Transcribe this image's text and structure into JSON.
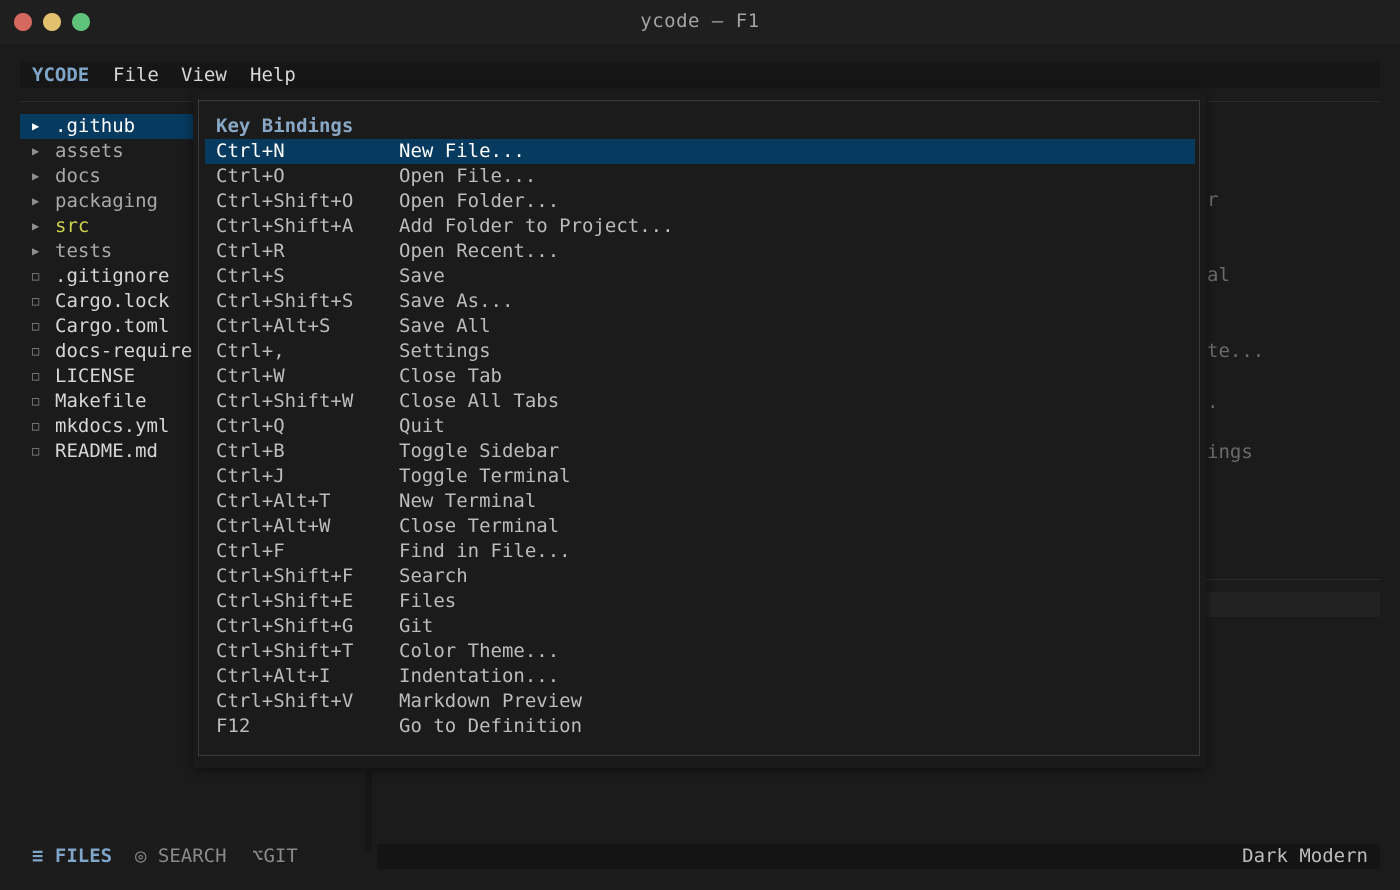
{
  "window": {
    "title": "ycode — F1"
  },
  "menubar": {
    "brand": "YCODE",
    "items": [
      "File",
      "View",
      "Help"
    ]
  },
  "sidebar": {
    "tree": [
      {
        "name": ".github",
        "type": "dir",
        "selected": true
      },
      {
        "name": "assets",
        "type": "dir"
      },
      {
        "name": "docs",
        "type": "dir"
      },
      {
        "name": "packaging",
        "type": "dir"
      },
      {
        "name": "src",
        "type": "dir",
        "modified": true
      },
      {
        "name": "tests",
        "type": "dir"
      },
      {
        "name": ".gitignore",
        "type": "file"
      },
      {
        "name": "Cargo.lock",
        "type": "file"
      },
      {
        "name": "Cargo.toml",
        "type": "file"
      },
      {
        "name": "docs-require",
        "type": "file"
      },
      {
        "name": "LICENSE",
        "type": "file"
      },
      {
        "name": "Makefile",
        "type": "file"
      },
      {
        "name": "mkdocs.yml",
        "type": "file"
      },
      {
        "name": "README.md",
        "type": "file"
      }
    ],
    "tabs": {
      "files": "≡ FILES",
      "search": "◎ SEARCH",
      "git": "⌥GIT"
    }
  },
  "background_text": [
    "r",
    "al",
    "te...",
    ".",
    "ings"
  ],
  "modal": {
    "title": "Key Bindings",
    "bindings": [
      {
        "key": "Ctrl+N",
        "action": "New File...",
        "selected": true
      },
      {
        "key": "Ctrl+O",
        "action": "Open File..."
      },
      {
        "key": "Ctrl+Shift+O",
        "action": "Open Folder..."
      },
      {
        "key": "Ctrl+Shift+A",
        "action": "Add Folder to Project..."
      },
      {
        "key": "Ctrl+R",
        "action": "Open Recent..."
      },
      {
        "key": "Ctrl+S",
        "action": "Save"
      },
      {
        "key": "Ctrl+Shift+S",
        "action": "Save As..."
      },
      {
        "key": "Ctrl+Alt+S",
        "action": "Save All"
      },
      {
        "key": "Ctrl+,",
        "action": "Settings"
      },
      {
        "key": "Ctrl+W",
        "action": "Close Tab"
      },
      {
        "key": "Ctrl+Shift+W",
        "action": "Close All Tabs"
      },
      {
        "key": "Ctrl+Q",
        "action": "Quit"
      },
      {
        "key": "Ctrl+B",
        "action": "Toggle Sidebar"
      },
      {
        "key": "Ctrl+J",
        "action": "Toggle Terminal"
      },
      {
        "key": "Ctrl+Alt+T",
        "action": "New Terminal"
      },
      {
        "key": "Ctrl+Alt+W",
        "action": "Close Terminal"
      },
      {
        "key": "Ctrl+F",
        "action": "Find in File..."
      },
      {
        "key": "Ctrl+Shift+F",
        "action": "Search"
      },
      {
        "key": "Ctrl+Shift+E",
        "action": "Files"
      },
      {
        "key": "Ctrl+Shift+G",
        "action": "Git"
      },
      {
        "key": "Ctrl+Shift+T",
        "action": "Color Theme..."
      },
      {
        "key": "Ctrl+Alt+I",
        "action": "Indentation..."
      },
      {
        "key": "Ctrl+Shift+V",
        "action": "Markdown Preview"
      },
      {
        "key": "F12",
        "action": "Go to Definition"
      }
    ]
  },
  "statusbar": {
    "theme": "Dark Modern"
  },
  "colors": {
    "accent": "#7fa6c9",
    "selection": "#073a5f",
    "modified": "#cdd34c"
  },
  "icons": {
    "dir": "triangle-right-icon",
    "file": "square-outline-icon"
  }
}
